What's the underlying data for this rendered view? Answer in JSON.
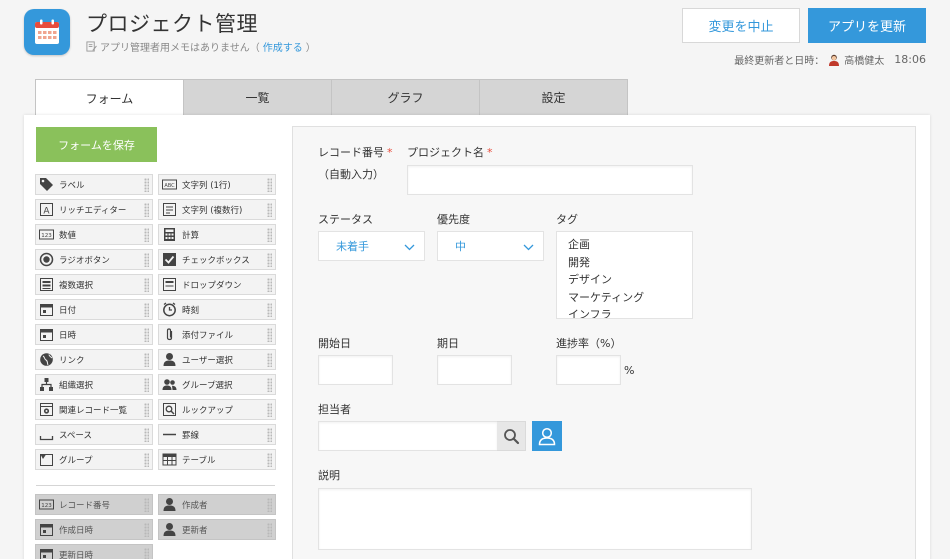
{
  "header": {
    "app_title": "プロジェクト管理",
    "memo_text": "アプリ管理者用メモはありません（",
    "memo_link": "作成する",
    "memo_close": "）",
    "cancel_label": "変更を中止",
    "update_label": "アプリを更新",
    "updated_label": "最終更新者と日時：",
    "updated_user": "高橋健太",
    "updated_time": "18:06"
  },
  "tabs": [
    {
      "label": "フォーム",
      "active": true
    },
    {
      "label": "一覧",
      "active": false
    },
    {
      "label": "グラフ",
      "active": false
    },
    {
      "label": "設定",
      "active": false
    }
  ],
  "palette": {
    "save_label": "フォームを保存",
    "items": [
      {
        "label": "ラベル",
        "icon": "tag-icon"
      },
      {
        "label": "文字列 (1行)",
        "icon": "text-line-icon"
      },
      {
        "label": "リッチエディター",
        "icon": "rich-editor-icon"
      },
      {
        "label": "文字列 (複数行)",
        "icon": "text-multiline-icon"
      },
      {
        "label": "数値",
        "icon": "number-icon"
      },
      {
        "label": "計算",
        "icon": "calculator-icon"
      },
      {
        "label": "ラジオボタン",
        "icon": "radio-icon"
      },
      {
        "label": "チェックボックス",
        "icon": "checkbox-icon"
      },
      {
        "label": "複数選択",
        "icon": "multi-select-icon"
      },
      {
        "label": "ドロップダウン",
        "icon": "dropdown-icon"
      },
      {
        "label": "日付",
        "icon": "calendar-icon"
      },
      {
        "label": "時刻",
        "icon": "clock-icon"
      },
      {
        "label": "日時",
        "icon": "datetime-icon"
      },
      {
        "label": "添付ファイル",
        "icon": "paperclip-icon"
      },
      {
        "label": "リンク",
        "icon": "globe-icon"
      },
      {
        "label": "ユーザー選択",
        "icon": "user-icon"
      },
      {
        "label": "組織選択",
        "icon": "org-icon"
      },
      {
        "label": "グループ選択",
        "icon": "group-icon"
      },
      {
        "label": "関連レコード一覧",
        "icon": "related-records-icon"
      },
      {
        "label": "ルックアップ",
        "icon": "lookup-icon"
      },
      {
        "label": "スペース",
        "icon": "space-icon"
      },
      {
        "label": "罫線",
        "icon": "line-icon"
      },
      {
        "label": "グループ",
        "icon": "group-folder-icon"
      },
      {
        "label": "テーブル",
        "icon": "table-icon"
      }
    ],
    "system_items": [
      {
        "label": "レコード番号",
        "icon": "number-icon"
      },
      {
        "label": "作成者",
        "icon": "user-icon"
      },
      {
        "label": "作成日時",
        "icon": "calendar-icon"
      },
      {
        "label": "更新者",
        "icon": "user-icon"
      },
      {
        "label": "更新日時",
        "icon": "calendar-icon"
      }
    ]
  },
  "form": {
    "record_no_label": "レコード番号",
    "record_no_value": "（自動入力）",
    "project_name_label": "プロジェクト名",
    "status_label": "ステータス",
    "status_value": "未着手",
    "priority_label": "優先度",
    "priority_value": "中",
    "tag_label": "タグ",
    "tag_options": [
      "企画",
      "開発",
      "デザイン",
      "マーケティング",
      "インフラ"
    ],
    "start_label": "開始日",
    "due_label": "期日",
    "progress_label": "進捗率（%）",
    "progress_unit": "%",
    "assignee_label": "担当者",
    "description_label": "説明"
  },
  "colors": {
    "accent": "#3498db",
    "save_green": "#8ac15b",
    "required": "#e74c3c"
  }
}
